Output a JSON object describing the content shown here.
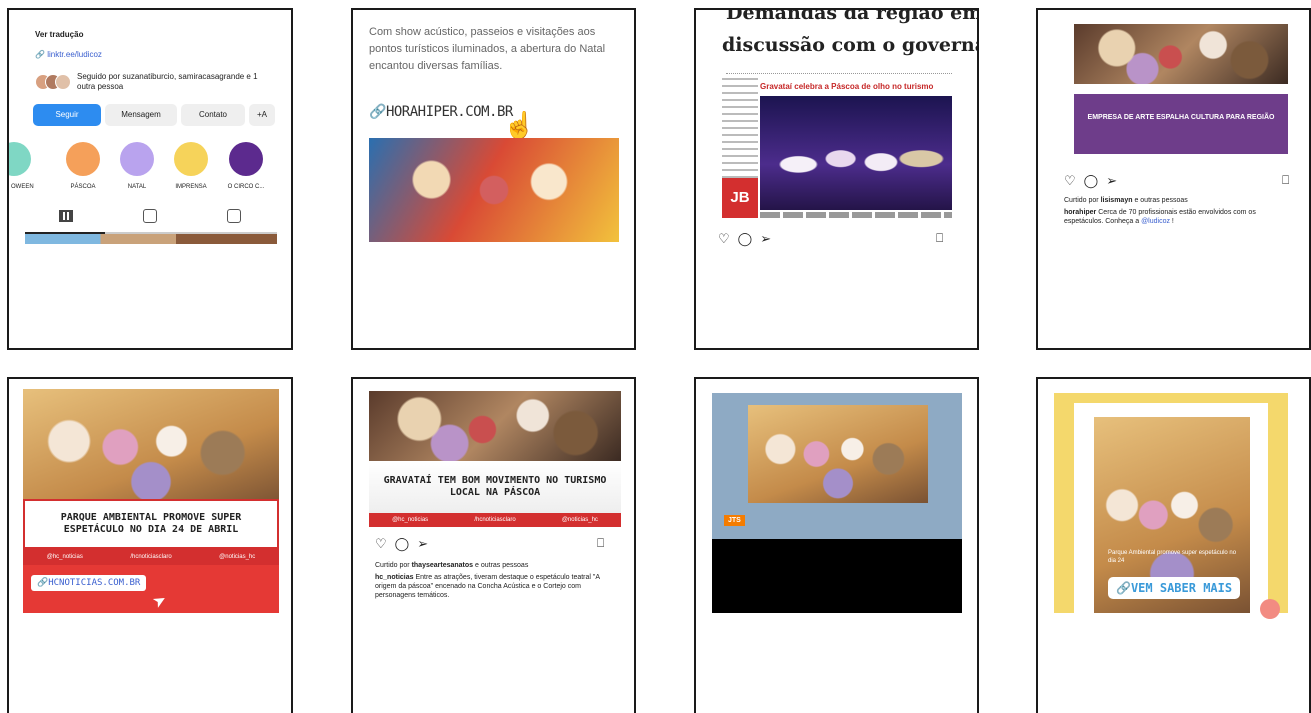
{
  "panel1": {
    "translate": "Ver tradução",
    "link": "linktr.ee/ludicoz",
    "followed_by": "Seguido por suzanatiburcio, samiracasagrande e 1 outra pessoa",
    "buttons": [
      "Seguir",
      "Mensagem",
      "Contato"
    ],
    "more_button": "+A",
    "highlights": [
      {
        "label": "OWEEN",
        "color": "#7fd7c4"
      },
      {
        "label": "PÁSCOA",
        "color": "#f5a05a"
      },
      {
        "label": "NATAL",
        "color": "#b9a3ee"
      },
      {
        "label": "IMPRENSA",
        "color": "#f6d35a"
      },
      {
        "label": "O CIRCO C...",
        "color": "#5c2a8e"
      }
    ],
    "tabs": [
      "grid-icon",
      "reels-icon",
      "tagged-icon"
    ]
  },
  "panel2": {
    "text": "Com show acústico, passeios e visitações aos pontos turísticos iluminados, a abertura do Natal encantou diversas famílias.",
    "link": "HORAHIPER.COM.BR"
  },
  "panel3": {
    "headline_top": "Demandas da região em",
    "headline": "discussão com o governador",
    "subhead": "Gravataí celebra a Páscoa de olho no turismo",
    "logo": "JB"
  },
  "panel4": {
    "banner": "EMPRESA DE ARTE ESPALHA CULTURA PARA REGIÃO",
    "liked_prefix": "Curtido por ",
    "liked_user": "lisismayn",
    "liked_suffix": " e outras pessoas",
    "caption_user": "horahiper",
    "caption_text": " Cerca de 70 profissionais estão envolvidos com os espetáculos. Conheça a ",
    "caption_mention": "@ludicoz",
    "caption_end": " !"
  },
  "panel5": {
    "headline": "PARQUE AMBIENTAL PROMOVE SUPER ESPETÁCULO NO DIA 24 DE ABRIL",
    "social": [
      "@hc_noticias",
      "/hcnoticiasclaro",
      "@noticias_hc"
    ],
    "link": "HCNOTICIAS.COM.BR"
  },
  "panel6": {
    "headline": "GRAVATAÍ TEM BOM MOVIMENTO NO TURISMO LOCAL NA PÁSCOA",
    "social": [
      "@hc_noticias",
      "/hcnoticiasclaro",
      "@noticias_hc"
    ],
    "liked_prefix": "Curtido por ",
    "liked_user": "thayseartesanatos",
    "liked_suffix": " e outras pessoas",
    "caption_user": "hc_noticias",
    "caption_text": " Entre as atrações, tiveram destaque o espetáculo teatral \"A origem da páscoa\" encenado na Concha Acústica e o Cortejo com personagens temáticos."
  },
  "panel7": {
    "badge": "JTS"
  },
  "panel8": {
    "small_text": "Parque Ambiental promove super espetáculo no dia 24",
    "link_sticker": "VEM SABER MAIS"
  }
}
